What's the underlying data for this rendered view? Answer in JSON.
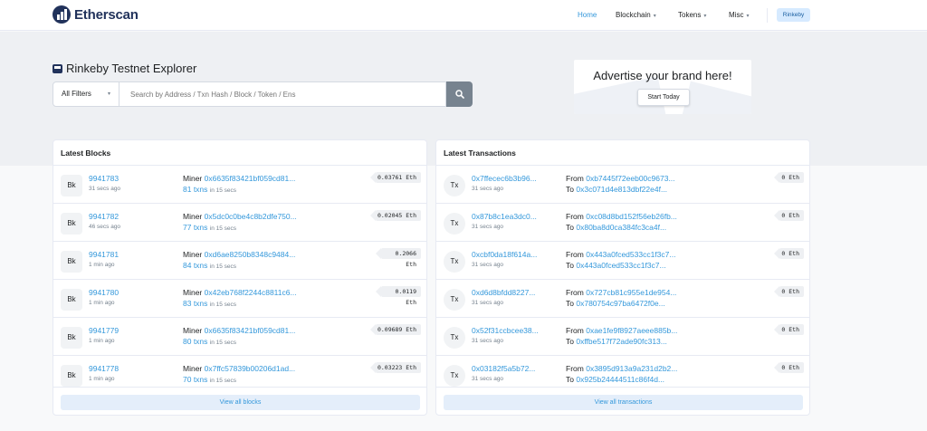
{
  "header": {
    "logo_text": "Etherscan",
    "nav": {
      "home": "Home",
      "blockchain": "Blockchain",
      "tokens": "Tokens",
      "misc": "Misc"
    },
    "network_badge": "Rinkeby"
  },
  "hero": {
    "title": "Rinkeby Testnet Explorer",
    "filter_label": "All Filters",
    "search_placeholder": "Search by Address / Txn Hash / Block / Token / Ens"
  },
  "ad": {
    "headline": "Advertise your brand here!",
    "button": "Start Today"
  },
  "latest_blocks": {
    "title": "Latest Blocks",
    "badge_label": "Bk",
    "miner_label": "Miner",
    "txns_suffix": "in 15 secs",
    "view_all": "View all blocks",
    "rows": [
      {
        "number": "9941783",
        "age": "31 secs ago",
        "miner": "0x6635f83421bf059cd81...",
        "txns": "81 txns",
        "reward": "0.03761 Eth"
      },
      {
        "number": "9941782",
        "age": "46 secs ago",
        "miner": "0x5dc0c0be4c8b2dfe750...",
        "txns": "77 txns",
        "reward": "0.02045 Eth"
      },
      {
        "number": "9941781",
        "age": "1 min ago",
        "miner": "0xd6ae8250b8348c9484...",
        "txns": "84 txns",
        "reward": "0.2066 Eth"
      },
      {
        "number": "9941780",
        "age": "1 min ago",
        "miner": "0x42eb768f2244c8811c6...",
        "txns": "83 txns",
        "reward": "0.0119 Eth"
      },
      {
        "number": "9941779",
        "age": "1 min ago",
        "miner": "0x6635f83421bf059cd81...",
        "txns": "80 txns",
        "reward": "0.09689 Eth"
      },
      {
        "number": "9941778",
        "age": "1 min ago",
        "miner": "0x7ffc57839b00206d1ad...",
        "txns": "70 txns",
        "reward": "0.03223 Eth"
      }
    ]
  },
  "latest_transactions": {
    "title": "Latest Transactions",
    "badge_label": "Tx",
    "from_label": "From",
    "to_label": "To",
    "view_all": "View all transactions",
    "rows": [
      {
        "hash": "0x7ffecec6b3b96...",
        "age": "31 secs ago",
        "from": "0xb7445f72eeb00c9673...",
        "to": "0x3c071d4e813dbf22e4f...",
        "value": "0 Eth"
      },
      {
        "hash": "0x87b8c1ea3dc0...",
        "age": "31 secs ago",
        "from": "0xc08d8bd152f56eb26fb...",
        "to": "0x80ba8d0ca384fc3ca4f...",
        "value": "0 Eth"
      },
      {
        "hash": "0xcbf0da18f614a...",
        "age": "31 secs ago",
        "from": "0x443a0fced533cc1f3c7...",
        "to": "0x443a0fced533cc1f3c7...",
        "value": "0 Eth"
      },
      {
        "hash": "0xd6d8bfdd8227...",
        "age": "31 secs ago",
        "from": "0x727cb81c955e1de954...",
        "to": "0x780754c97ba6472f0e...",
        "value": "0 Eth"
      },
      {
        "hash": "0x52f31ccbcee38...",
        "age": "31 secs ago",
        "from": "0xae1fe9f8927aeee885b...",
        "to": "0xffbe517f72ade90fc313...",
        "value": "0 Eth"
      },
      {
        "hash": "0x03182f5a5b72...",
        "age": "31 secs ago",
        "from": "0x3895d913a9a231d2b2...",
        "to": "0x925b24444511c86f4d...",
        "value": "0 Eth"
      }
    ]
  }
}
